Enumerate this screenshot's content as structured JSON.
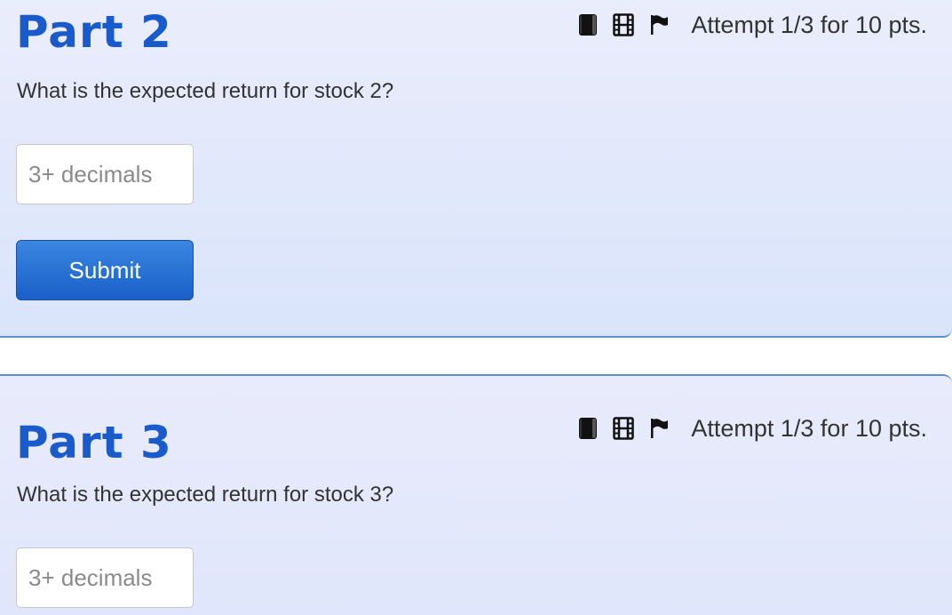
{
  "parts": [
    {
      "title": "Part 2",
      "question": "What is the expected return for stock 2?",
      "input_placeholder": "3+ decimals",
      "attempt_text": "Attempt 1/3 for 10 pts.",
      "submit_label": "Submit"
    },
    {
      "title": "Part 3",
      "question": "What is the expected return for stock 3?",
      "input_placeholder": "3+ decimals",
      "attempt_text": "Attempt 1/3 for 10 pts."
    }
  ],
  "icons": [
    "book-icon",
    "film-icon",
    "flag-icon"
  ],
  "colors": {
    "title": "#1a5bcc",
    "submit_button": "#2470d6",
    "card_border": "#5b8fcf",
    "card_background": "#e3e9fb"
  }
}
